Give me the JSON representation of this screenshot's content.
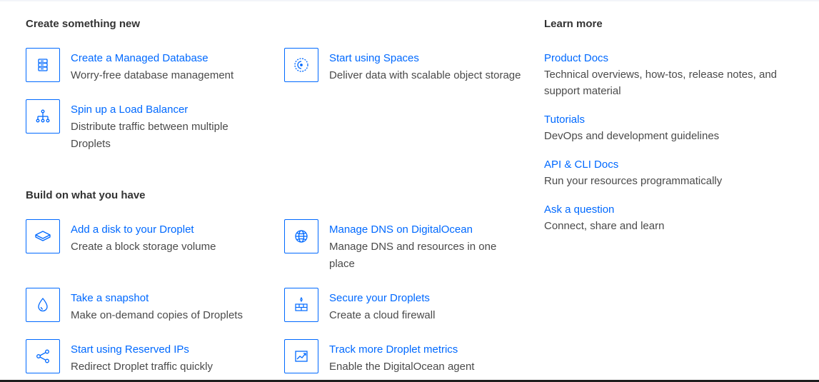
{
  "create": {
    "heading": "Create something new",
    "items": [
      {
        "title": "Create a Managed Database",
        "desc": "Worry-free database management",
        "icon": "database-icon"
      },
      {
        "title": "Start using Spaces",
        "desc": "Deliver data with scalable object storage",
        "icon": "spaces-icon"
      },
      {
        "title": "Spin up a Load Balancer",
        "desc": "Distribute traffic between multiple Droplets",
        "icon": "load-balancer-icon"
      }
    ]
  },
  "build": {
    "heading": "Build on what you have",
    "items": [
      {
        "title": "Add a disk to your Droplet",
        "desc": "Create a block storage volume",
        "icon": "disk-icon"
      },
      {
        "title": "Manage DNS on DigitalOcean",
        "desc": "Manage DNS and resources in one place",
        "icon": "globe-icon"
      },
      {
        "title": "Take a snapshot",
        "desc": "Make on-demand copies of Droplets",
        "icon": "droplet-icon"
      },
      {
        "title": "Secure your Droplets",
        "desc": "Create a cloud firewall",
        "icon": "firewall-icon"
      },
      {
        "title": "Start using Reserved IPs",
        "desc": "Redirect Droplet traffic quickly",
        "icon": "share-icon"
      },
      {
        "title": "Track more Droplet metrics",
        "desc": "Enable the DigitalOcean agent",
        "icon": "metrics-icon"
      }
    ]
  },
  "learn": {
    "heading": "Learn more",
    "items": [
      {
        "title": "Product Docs",
        "desc": "Technical overviews, how-tos, release notes, and support material"
      },
      {
        "title": "Tutorials",
        "desc": "DevOps and development guidelines"
      },
      {
        "title": "API & CLI Docs",
        "desc": "Run your resources programmatically"
      },
      {
        "title": "Ask a question",
        "desc": "Connect, share and learn"
      }
    ]
  },
  "colors": {
    "accent": "#0069ff",
    "text": "#333333",
    "muted": "#4a4a4a"
  }
}
